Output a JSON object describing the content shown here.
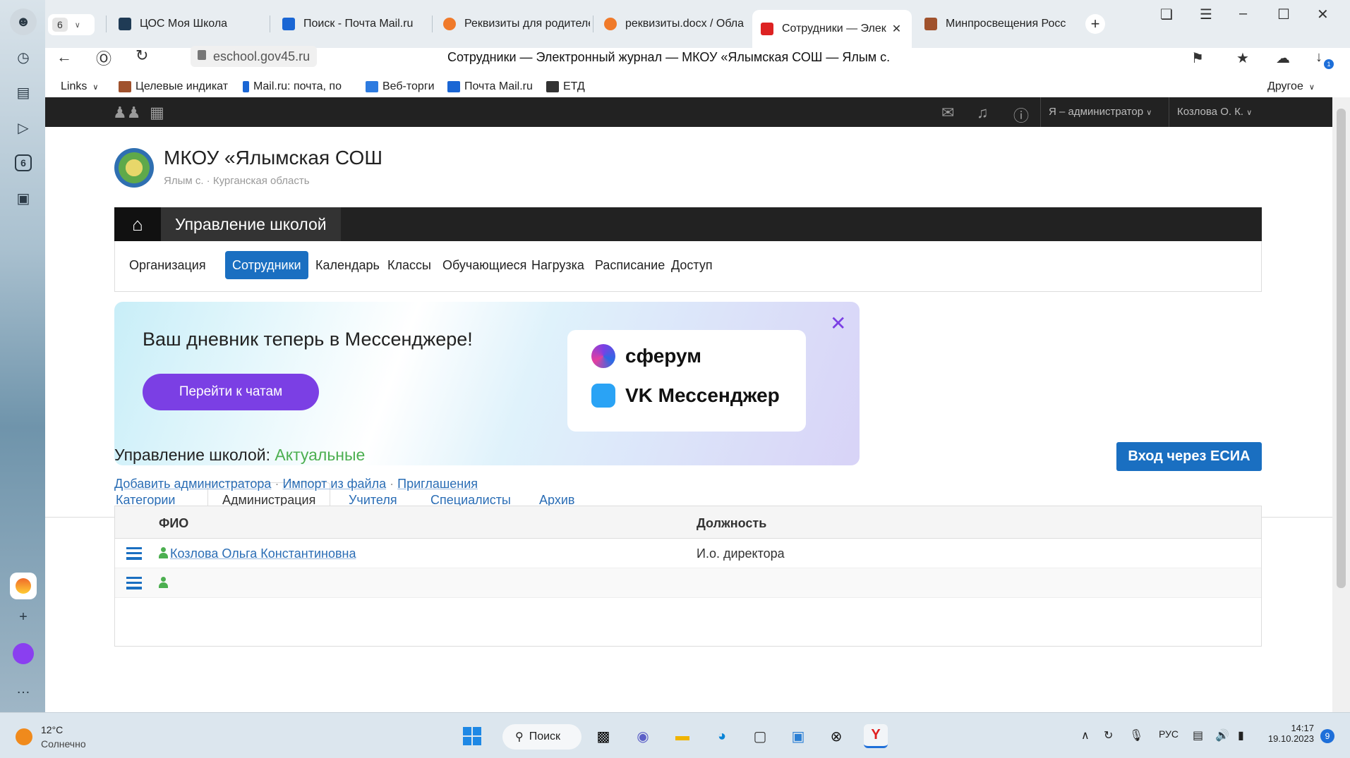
{
  "browser": {
    "tab_count": "6",
    "tabs": [
      {
        "title": "ЦОС Моя Школа"
      },
      {
        "title": "Поиск - Почта Mail.ru"
      },
      {
        "title": "Реквизиты для родителе"
      },
      {
        "title": "реквизиты.docx / Обла"
      },
      {
        "title": "Сотрудники — Элек"
      },
      {
        "title": "Минпросвещения Росс"
      }
    ],
    "url": "eschool.gov45.ru",
    "page_title": "Сотрудники — Электронный журнал — МКОУ «Ялымская СОШ — Ялым с.",
    "bookmarks": [
      {
        "label": "Links"
      },
      {
        "label": "Целевые индикат"
      },
      {
        "label": "Mail.ru: почта, по"
      },
      {
        "label": "Веб-торги"
      },
      {
        "label": "Почта Mail.ru"
      },
      {
        "label": "ЕТД"
      }
    ],
    "other_bookmarks": "Другое",
    "download_badge": "1"
  },
  "site": {
    "topnav": {
      "role": "Я – администратор",
      "user": "Козлова О. К."
    },
    "school": {
      "name": "МКОУ «Ялымская СОШ",
      "location": "Ялым с. · Курганская область"
    },
    "management_title": "Управление школой",
    "subnav": [
      {
        "label": "Организация"
      },
      {
        "label": "Сотрудники"
      },
      {
        "label": "Календарь"
      },
      {
        "label": "Классы"
      },
      {
        "label": "Обучающиеся"
      },
      {
        "label": "Нагрузка"
      },
      {
        "label": "Расписание"
      },
      {
        "label": "Доступ"
      }
    ],
    "banner": {
      "title": "Ваш дневник теперь в Мессенджере!",
      "button": "Перейти к чатам",
      "brand1": "сферум",
      "brand2": "VK Мессенджер"
    },
    "staff_tabs": [
      {
        "label": "Категории"
      },
      {
        "label": "Администрация"
      },
      {
        "label": "Учителя"
      },
      {
        "label": "Специалисты"
      },
      {
        "label": "Архив"
      }
    ],
    "section": {
      "prefix": "Управление школой:",
      "status": "Актуальные",
      "esia_button": "Вход через ЕСИА"
    },
    "links": {
      "add": "Добавить администратора",
      "sep": "·",
      "import": "Импорт из файла",
      "invites": "Приглашения"
    },
    "table": {
      "headers": {
        "fio": "ФИО",
        "position": "Должность"
      },
      "rows": [
        {
          "fio": "Козлова Ольга Константиновна",
          "position": "И.о. директора"
        }
      ]
    }
  },
  "taskbar": {
    "temperature": "12°C",
    "weather": "Солнечно",
    "search": "Поиск",
    "lang": "РУС",
    "time": "14:17",
    "date": "19.10.2023",
    "notifications": "9"
  },
  "colors": {
    "accent": "#1a6fc1",
    "banner_button": "#7b3fe4",
    "status_green": "#4caf50"
  }
}
